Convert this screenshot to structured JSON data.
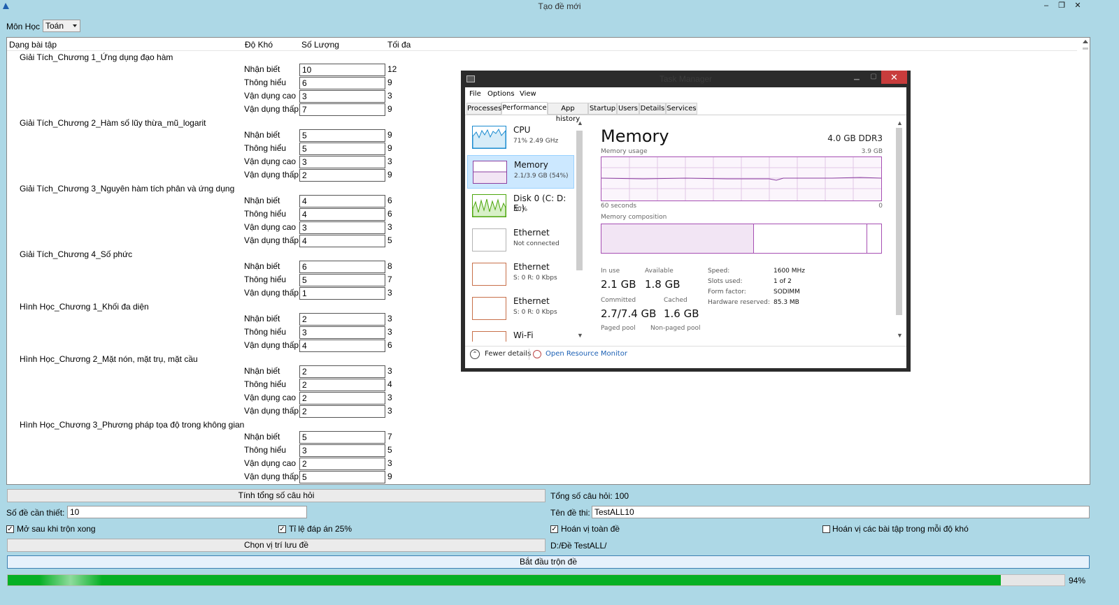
{
  "window": {
    "title": "Tạo đề mới",
    "minimize": "–",
    "restore": "❐",
    "close": "✕"
  },
  "subject": {
    "label": "Môn Học",
    "value": "Toán"
  },
  "table": {
    "headers": [
      "Dạng bài tập",
      "Độ Khó",
      "Số Lượng",
      "Tối đa"
    ],
    "groups": [
      {
        "name": "Giải Tích_Chương 1_Ứng dụng đạo hàm",
        "rows": [
          {
            "level": "Nhận biết",
            "qty": "10",
            "max": "12"
          },
          {
            "level": "Thông hiểu",
            "qty": "6",
            "max": "9"
          },
          {
            "level": "Vận dụng cao",
            "qty": "3",
            "max": "3"
          },
          {
            "level": "Vận dụng thấp",
            "qty": "7",
            "max": "9"
          }
        ]
      },
      {
        "name": "Giải Tích_Chương 2_Hàm số lũy thừa_mũ_logarit",
        "rows": [
          {
            "level": "Nhận biết",
            "qty": "5",
            "max": "9"
          },
          {
            "level": "Thông hiểu",
            "qty": "5",
            "max": "9"
          },
          {
            "level": "Vận dụng cao",
            "qty": "3",
            "max": "3"
          },
          {
            "level": "Vận dụng thấp",
            "qty": "2",
            "max": "9"
          }
        ]
      },
      {
        "name": "Giải Tích_Chương 3_Nguyên hàm tích phân và ứng dụng",
        "rows": [
          {
            "level": "Nhận biết",
            "qty": "4",
            "max": "6"
          },
          {
            "level": "Thông hiểu",
            "qty": "4",
            "max": "6"
          },
          {
            "level": "Vận dụng cao",
            "qty": "3",
            "max": "3"
          },
          {
            "level": "Vận dụng thấp",
            "qty": "4",
            "max": "5"
          }
        ]
      },
      {
        "name": "Giải Tích_Chương 4_Số phức",
        "rows": [
          {
            "level": "Nhận biết",
            "qty": "6",
            "max": "8"
          },
          {
            "level": "Thông hiểu",
            "qty": "5",
            "max": "7"
          },
          {
            "level": "Vận dụng thấp",
            "qty": "1",
            "max": "3"
          }
        ]
      },
      {
        "name": "Hình Học_Chương 1_Khối đa diện",
        "rows": [
          {
            "level": "Nhận biết",
            "qty": "2",
            "max": "3"
          },
          {
            "level": "Thông hiểu",
            "qty": "3",
            "max": "3"
          },
          {
            "level": "Vận dụng thấp",
            "qty": "4",
            "max": "6"
          }
        ]
      },
      {
        "name": "Hình Học_Chương 2_Mặt nón, mặt trụ, mặt cầu",
        "rows": [
          {
            "level": "Nhận biết",
            "qty": "2",
            "max": "3"
          },
          {
            "level": "Thông hiểu",
            "qty": "2",
            "max": "4"
          },
          {
            "level": "Vận dụng cao",
            "qty": "2",
            "max": "3"
          },
          {
            "level": "Vận dụng thấp",
            "qty": "2",
            "max": "3"
          }
        ]
      },
      {
        "name": "Hình Học_Chương 3_Phương pháp tọa độ trong không gian",
        "rows": [
          {
            "level": "Nhận biết",
            "qty": "5",
            "max": "7"
          },
          {
            "level": "Thông hiểu",
            "qty": "3",
            "max": "5"
          },
          {
            "level": "Vận dụng cao",
            "qty": "2",
            "max": "3"
          },
          {
            "level": "Vận dụng thấp",
            "qty": "5",
            "max": "9"
          }
        ]
      }
    ]
  },
  "task_manager": {
    "title": "Task Manager",
    "menu": [
      "File",
      "Options",
      "View"
    ],
    "tabs": [
      "Processes",
      "Performance",
      "App history",
      "Startup",
      "Users",
      "Details",
      "Services"
    ],
    "active_tab": "Performance",
    "resources": [
      {
        "name": "CPU",
        "sub": "71% 2.49 GHz",
        "color": "#1a8bd0"
      },
      {
        "name": "Memory",
        "sub": "2.1/3.9 GB (54%)",
        "color": "#8b3fa0"
      },
      {
        "name": "Disk 0 (C: D: E:)",
        "sub": "50%",
        "color": "#4da60c"
      },
      {
        "name": "Ethernet",
        "sub": "Not connected",
        "color": "#b3b3b3"
      },
      {
        "name": "Ethernet",
        "sub": "S: 0 R: 0 Kbps",
        "color": "#c8704a"
      },
      {
        "name": "Ethernet",
        "sub": "S: 0 R: 0 Kbps",
        "color": "#c8704a"
      },
      {
        "name": "Wi-Fi",
        "sub": "",
        "color": "#c8704a"
      }
    ],
    "memory": {
      "title": "Memory",
      "spec": "4.0 GB DDR3",
      "usage_label": "Memory usage",
      "usage_max": "3.9 GB",
      "time_left": "60 seconds",
      "time_right": "0",
      "composition_label": "Memory composition",
      "in_use_label": "In use",
      "in_use": "2.1 GB",
      "available_label": "Available",
      "available": "1.8 GB",
      "committed_label": "Committed",
      "committed": "2.7/7.4 GB",
      "cached_label": "Cached",
      "cached": "1.6 GB",
      "paged_label": "Paged pool",
      "nonpaged_label": "Non-paged pool",
      "speed_label": "Speed:",
      "speed": "1600 MHz",
      "slots_label": "Slots used:",
      "slots": "1 of 2",
      "form_label": "Form factor:",
      "form": "SODIMM",
      "reserved_label": "Hardware reserved:",
      "reserved": "85.3 MB"
    },
    "footer": {
      "fewer": "Fewer details",
      "monitor": "Open Resource Monitor"
    }
  },
  "controls": {
    "calc_button": "Tính tổng số câu hỏi",
    "total_label": "Tổng số câu hỏi: 100",
    "num_tests_label": "Số đề cần thiết:",
    "num_tests_value": "10",
    "test_name_label": "Tên đề thi:",
    "test_name_value": "TestALL10",
    "open_after": {
      "label": "Mở sau khi trộn xong",
      "checked": true
    },
    "ratio": {
      "label": "Tỉ lệ đáp án 25%",
      "checked": true
    },
    "permute_all": {
      "label": "Hoán vị toàn đề",
      "checked": true
    },
    "permute_each": {
      "label": "Hoán vị các bài tập trong mỗi độ khó",
      "checked": false
    },
    "choose_location_button": "Chọn vị trí lưu đề",
    "save_path": "D:/Đề TestALL/",
    "start_button": "Bắt đầu trộn đề",
    "progress_percent": 94,
    "progress_label": "94%"
  }
}
